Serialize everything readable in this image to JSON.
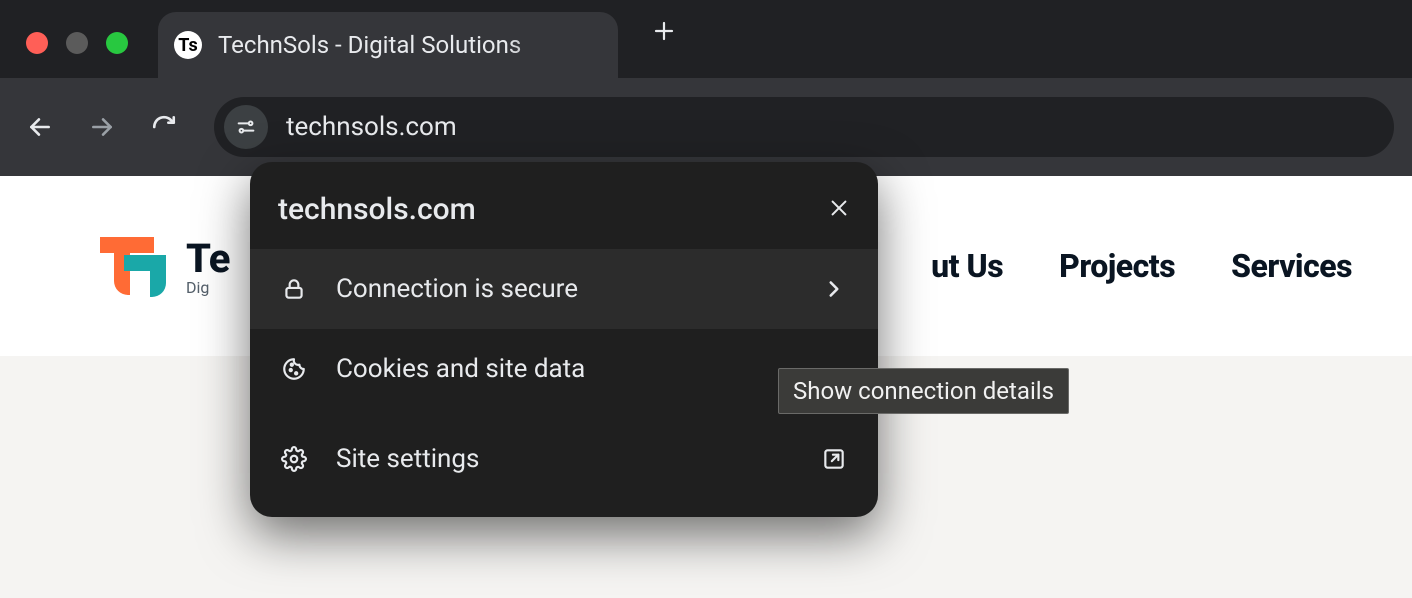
{
  "browser": {
    "tab_title": "TechnSols - Digital Solutions ",
    "favicon_letter": "Ts",
    "address": "technsols.com"
  },
  "page": {
    "brand_name": "Te",
    "brand_tag": "Dig",
    "nav": {
      "about": "ut Us",
      "projects": "Projects",
      "services": "Services"
    }
  },
  "siteinfo": {
    "domain": "technsols.com",
    "rows": {
      "connection": "Connection is secure",
      "cookies": "Cookies and site data",
      "settings": "Site settings"
    }
  },
  "tooltip": "Show connection details"
}
